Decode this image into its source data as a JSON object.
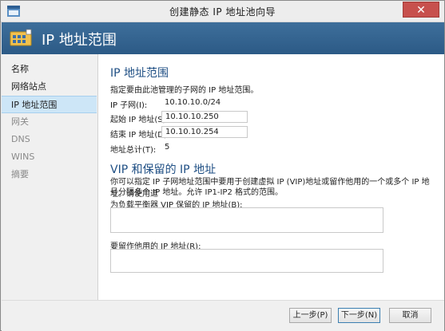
{
  "window": {
    "title": "创建静态 IP 地址池向导",
    "close_glyph": "✕"
  },
  "banner": {
    "title": "IP 地址范围"
  },
  "nav": {
    "items": [
      {
        "label": "名称",
        "state": "normal"
      },
      {
        "label": "网络站点",
        "state": "normal"
      },
      {
        "label": "IP 地址范围",
        "state": "active"
      },
      {
        "label": "网关",
        "state": "disabled"
      },
      {
        "label": "DNS",
        "state": "disabled"
      },
      {
        "label": "WINS",
        "state": "disabled"
      },
      {
        "label": "摘要",
        "state": "disabled"
      }
    ]
  },
  "range_section": {
    "heading": "IP 地址范围",
    "description": "指定要由此池管理的子网的 IP 地址范围。",
    "subnet_label": "IP 子网(I):",
    "subnet_value": "10.10.10.0/24",
    "start_label": "起始 IP 地址(S):",
    "start_value": "10.10.10.250",
    "end_label": "结束 IP 地址(D):",
    "end_value": "10.10.10.254",
    "total_label": "地址总计(T):",
    "total_value": "5"
  },
  "vip_section": {
    "heading": "VIP 和保留的 IP 地址",
    "description_line1": "你可以指定 IP 子网地址范围中要用于创建虚拟 IP (VIP)地址或留作他用的一个或多个 IP 地址。请使用逗",
    "description_line2": "号分隔多个 IP 地址。允许 IP1-IP2 格式的范围。",
    "vip_label": "为负载平衡器 VIP 保留的 IP 地址(B):",
    "vip_value": "",
    "reserved_label": "要留作他用的 IP 地址(R):",
    "reserved_value": ""
  },
  "footer": {
    "prev": "上一步(P)",
    "next": "下一步(N)",
    "cancel": "取消"
  },
  "colors": {
    "banner": "#2c5a86",
    "heading": "#1f4f84",
    "nav_active": "#cde6f7",
    "close": "#c7504d"
  }
}
